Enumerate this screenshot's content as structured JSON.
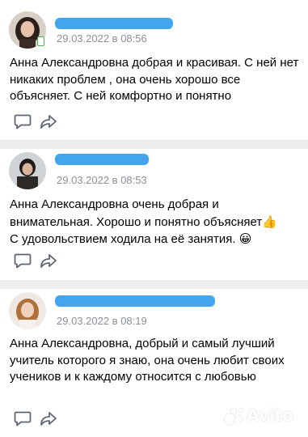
{
  "reviews": [
    {
      "date": "29.03.2022 в 08:56",
      "text": "Анна Александровна добрая и красивая. С ней нет никаких проблем , она очень хорошо все объясняет. С ней комфортно и понятно",
      "emoji_after": ""
    },
    {
      "date": "29.03.2022 в 08:53",
      "text": "Анна Александровна очень добрая и внимательная. Хорошо и понятно объясняет",
      "emoji_inline": "👍",
      "text_cont": "С удовольствием ходила на её занятия.",
      "emoji_after": "😀"
    },
    {
      "date": "29.03.2022 в 08:19",
      "text": "Анна Александровна, добрый и самый лучший учитель которого я знаю, она очень любит своих учеников и к каждому относится с любовью",
      "emoji_after": ""
    }
  ],
  "watermark": "Avito",
  "colors": {
    "divider": "#ededf0",
    "date": "#8a9099",
    "redaction": "#3aa0ee",
    "icon": "#5d6670",
    "online": "#4bb34b"
  },
  "icons": [
    "comment-icon",
    "share-icon"
  ]
}
